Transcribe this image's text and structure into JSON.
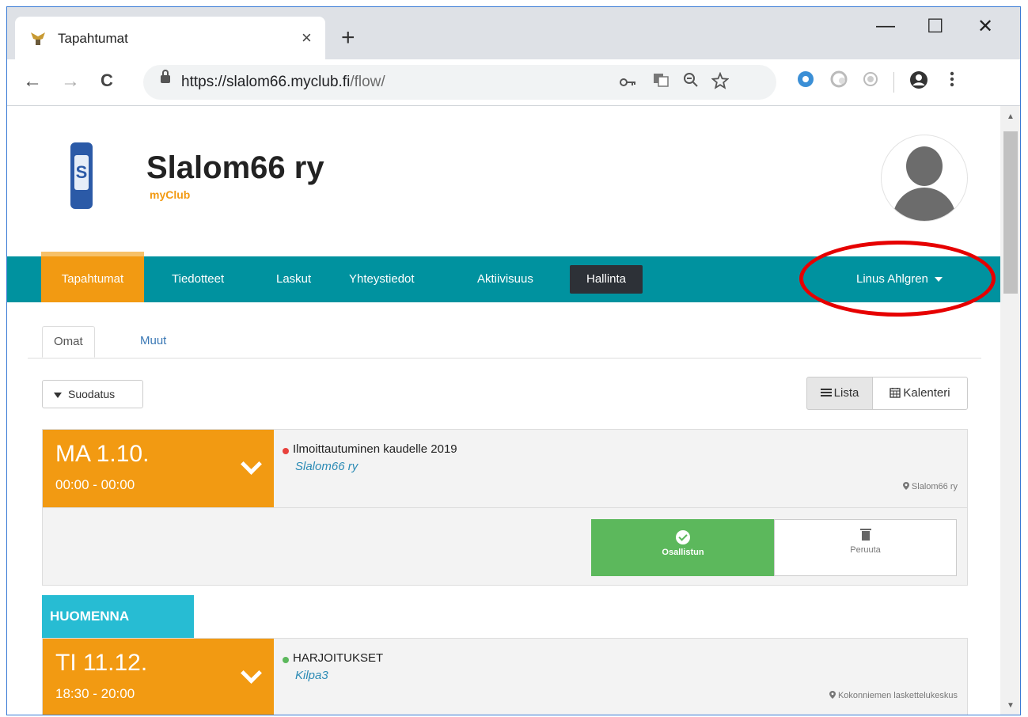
{
  "browser": {
    "tab_title": "Tapahtumat",
    "tab_close": "×",
    "new_tab": "+",
    "window_controls": {
      "minimize": "—",
      "maximize": "☐",
      "close": "✕"
    },
    "nav": {
      "back": "←",
      "forward": "→",
      "reload": "C"
    },
    "url_host": "https://slalom66.myclub.fi",
    "url_path": "/flow/",
    "omnibox_icons": [
      "key-icon",
      "translate-icon",
      "zoom-icon",
      "star-icon"
    ],
    "extension_icons": [
      "extension-blue-icon",
      "extension-gray-icon",
      "extension-gray2-icon",
      "account-icon",
      "menu-icon"
    ]
  },
  "site": {
    "title": "Slalom66 ry",
    "subtitle": "myClub"
  },
  "main_nav": {
    "items": [
      "Tapahtumat",
      "Tiedotteet",
      "Laskut",
      "Yhteystiedot",
      "Aktiivisuus",
      "Hallinta"
    ],
    "user": "Linus Ahlgren"
  },
  "sub_tabs": [
    "Omat",
    "Muut"
  ],
  "toolbar": {
    "filter": "Suodatus",
    "view_list": "Lista",
    "view_calendar": "Kalenteri"
  },
  "events": [
    {
      "date": "MA 1.10.",
      "time": "00:00 - 00:00",
      "status_color": "#e8413c",
      "title": "Ilmoittautuminen kaudelle 2019",
      "group": "Slalom66 ry",
      "location": "Slalom66 ry",
      "attend": "Osallistun",
      "cancel": "Peruuta"
    },
    {
      "date": "TI 11.12.",
      "time": "18:30 - 20:00",
      "status_color": "#5cb85c",
      "title": "HARJOITUKSET",
      "group": "Kilpa3",
      "location": "Kokonniemen laskettelukeskus"
    }
  ],
  "section_label": "HUOMENNA",
  "colors": {
    "accent": "#f29a12",
    "nav": "#00929f",
    "section": "#27bcd3",
    "annotation": "#e60000"
  }
}
